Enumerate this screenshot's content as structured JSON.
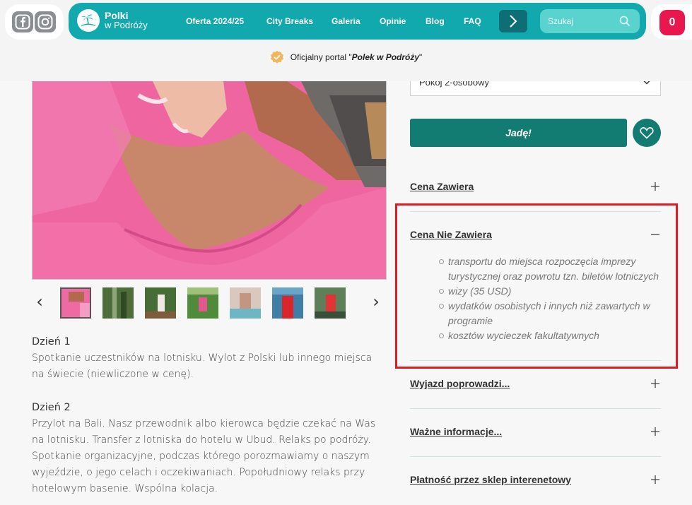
{
  "header": {
    "social": {
      "facebook_icon": "facebook-icon",
      "instagram_icon": "instagram-icon"
    },
    "logo": {
      "line1": "Polki",
      "line2": "w Podróży",
      "icon": "palm-island-icon"
    },
    "nav": [
      {
        "label": "Oferta 2024/25"
      },
      {
        "label": "City Breaks"
      },
      {
        "label": "Galeria"
      },
      {
        "label": "Opinie"
      },
      {
        "label": "Blog"
      },
      {
        "label": "FAQ"
      }
    ],
    "search": {
      "placeholder": "Szukaj"
    },
    "cart": {
      "count": "0"
    },
    "official": {
      "prefix": "Oficjalny portal \"",
      "brand": "Polek w Podróży",
      "suffix": "\""
    },
    "colors": {
      "nav_bg": "#12a9ae",
      "nav_arrow_bg": "#0e6e75",
      "search_bg": "#5ad3cf",
      "cart_badge": "#e8174d"
    }
  },
  "gallery": {
    "prev_label": "‹",
    "next_label": "›",
    "thumbnails": 7
  },
  "itinerary": [
    {
      "title": "Dzień 1",
      "text": "Spotkanie uczestników na lotnisku. Wylot z Polski lub innego miejsca na świecie (niewliczone w cenę)."
    },
    {
      "title": "Dzień 2",
      "text": "Przylot na Bali. Nasz przewodnik albo kierowca będzie czekać na Was na lotnisku. Transfer z lotniska do hotelu w Ubud. Relaks po podróży. Spotkanie organizacyjne, podczas którego porozmawiamy o naszym wyjeździe, o jego celach i oczekiwaniach. Popołudniowy relaks przy hotelowym basenie. Wspólna kolacja."
    }
  ],
  "booking": {
    "room_select": "Pokój 2-osobowy",
    "go_button": "Jadę!",
    "accent": "#137c72"
  },
  "accordion": [
    {
      "title": "Cena Zawiera",
      "toggle": "+"
    },
    {
      "title": "Cena Nie Zawiera",
      "toggle": "−",
      "items": [
        "transportu do miejsca rozpoczęcia imprezy turystycznej oraz powrotu tzn. biletów lotniczych",
        "wizy (35 USD)",
        "wydatków osobistych i innych niż zawartych w programie",
        "kosztów wycieczek fakultatywnych"
      ]
    },
    {
      "title": "Wyjazd poprowadzi...",
      "toggle": "+"
    },
    {
      "title": "Ważne informacje...",
      "toggle": "+"
    },
    {
      "title": "Płatność przez sklep interenetowy",
      "toggle": "+"
    }
  ],
  "highlight_color": "#e01b22"
}
